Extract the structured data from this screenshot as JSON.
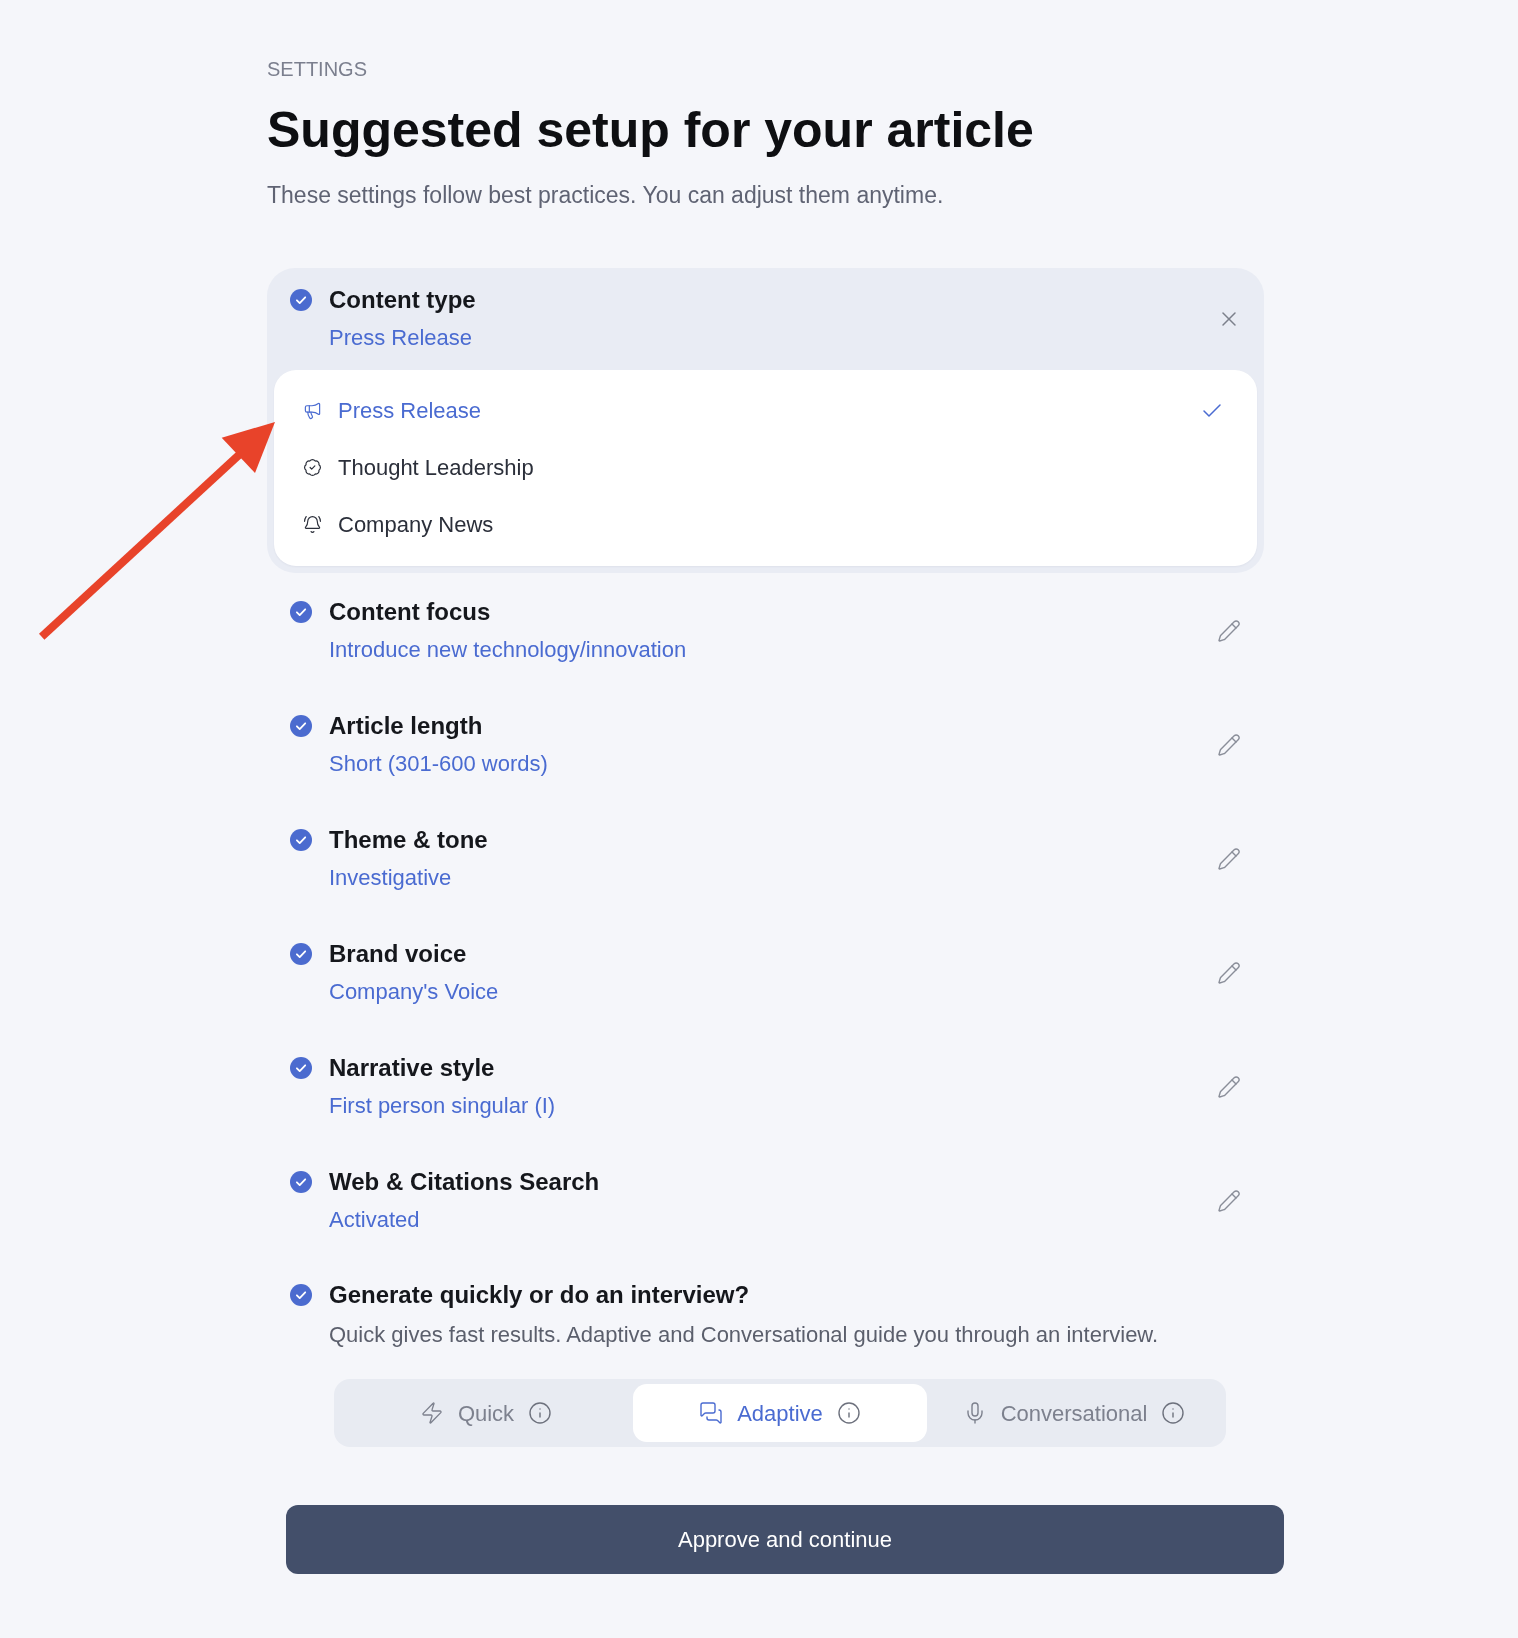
{
  "header": {
    "eyebrow": "SETTINGS",
    "title": "Suggested setup for your article",
    "subtitle": "These settings follow best practices. You can adjust them anytime."
  },
  "settings": [
    {
      "kind": "choice",
      "title": "Content type",
      "value": "Press Release",
      "checked": true,
      "expanded": true,
      "options": [
        {
          "label": "Press Release",
          "selected": true
        },
        {
          "label": "Thought Leadership",
          "selected": false
        },
        {
          "label": "Company News",
          "selected": false
        }
      ]
    },
    {
      "kind": "text",
      "title": "Content focus",
      "value": "Introduce new technology/innovation",
      "checked": true,
      "expanded": false
    },
    {
      "kind": "text",
      "title": "Article length",
      "value": "Short (301-600 words)",
      "checked": true,
      "expanded": false
    },
    {
      "kind": "text",
      "title": "Theme & tone",
      "value": "Investigative",
      "checked": true,
      "expanded": false
    },
    {
      "kind": "text",
      "title": "Brand voice",
      "value": "Company's Voice",
      "checked": true,
      "expanded": false
    },
    {
      "kind": "text",
      "title": "Narrative style",
      "value": "First person singular (I)",
      "checked": true,
      "expanded": false
    },
    {
      "kind": "text",
      "title": "Web & Citations Search",
      "value": "Activated",
      "checked": true,
      "expanded": false
    },
    {
      "kind": "mode",
      "title": "Generate quickly or do an interview?",
      "description": "Quick gives fast results. Adaptive and Conversational guide you through an interview.",
      "checked": true,
      "modes": [
        {
          "label": "Quick",
          "selected": false
        },
        {
          "label": "Adaptive",
          "selected": true
        },
        {
          "label": "Conversational",
          "selected": false
        }
      ]
    }
  ],
  "primary_button": {
    "label": "Approve and continue"
  }
}
